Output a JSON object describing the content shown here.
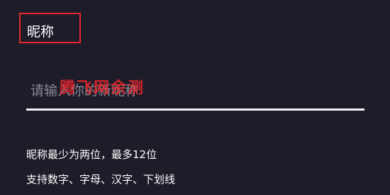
{
  "form": {
    "nickname_label": "昵称",
    "nickname_placeholder": "请输入你的新昵称",
    "nickname_value": "",
    "hints": [
      "昵称最少为两位，最多12位",
      "支持数字、字母、汉字、下划线"
    ]
  },
  "watermark": {
    "text": "腾飞网余测"
  },
  "colors": {
    "background": "#1d1c28",
    "text": "#ffffff",
    "placeholder": "#8a8996",
    "underline": "#f3f3f5",
    "highlight": "#e8272e"
  }
}
